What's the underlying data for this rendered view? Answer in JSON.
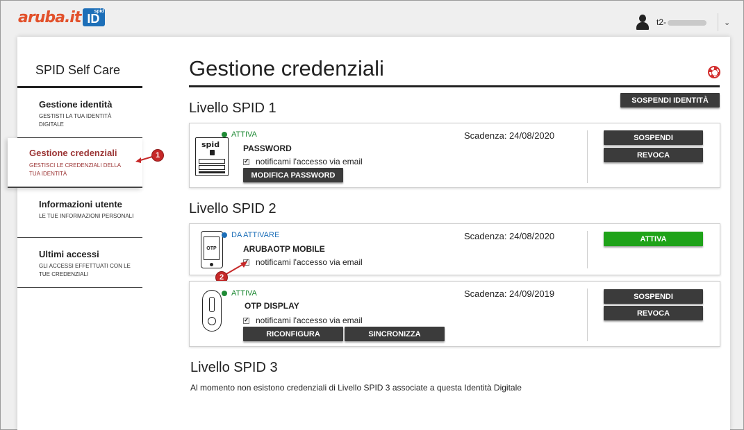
{
  "header": {
    "logo_text": "aruba.it",
    "logo_badge_top": "spid",
    "logo_badge_main": "ID",
    "user_prefix": "t2-"
  },
  "sidebar": {
    "title": "SPID Self Care",
    "items": [
      {
        "label": "Gestione identità",
        "sub": "GESTISTI LA TUA IDENTITÀ DIGITALE"
      },
      {
        "label": "Gestione credenziali",
        "sub": "GESTISCI LE CREDENZIALI DELLA TUA IDENTITÀ"
      },
      {
        "label": "Informazioni utente",
        "sub": "LE TUE INFORMAZIONI PERSONALI"
      },
      {
        "label": "Ultimi accessi",
        "sub": "GLI ACCESSI EFFETTUATI CON LE TUE CREDENZIALI"
      }
    ]
  },
  "callouts": [
    "1",
    "2"
  ],
  "main": {
    "title": "Gestione credenziali",
    "suspend_identity": "SOSPENDI IDENTITÀ",
    "level1": {
      "title": "Livello SPID 1",
      "cred": {
        "status": "ATTIVA",
        "name": "PASSWORD",
        "notify": "notificami l'accesso via email",
        "expiry": "Scadenza: 24/08/2020",
        "action": "MODIFICA PASSWORD",
        "btn1": "SOSPENDI",
        "btn2": "REVOCA",
        "device_label": "spid"
      }
    },
    "level2": {
      "title": "Livello SPID 2",
      "cred1": {
        "status": "DA ATTIVARE",
        "name": "ARUBAOTP MOBILE",
        "notify": "notificami l'accesso via email",
        "expiry": "Scadenza: 24/08/2020",
        "btn1": "ATTIVA",
        "device_label": "OTP"
      },
      "cred2": {
        "status": "ATTIVA",
        "name": "OTP DISPLAY",
        "notify": "notificami l'accesso via email",
        "expiry": "Scadenza: 24/09/2019",
        "action1": "RICONFIGURA",
        "action2": "SINCRONIZZA",
        "btn1": "SOSPENDI",
        "btn2": "REVOCA"
      }
    },
    "level3": {
      "title": "Livello SPID 3",
      "text": "Al momento non esistono credenziali di Livello SPID 3 associate a questa Identità Digitale"
    }
  },
  "colors": {
    "active": "#1e8a34",
    "pending": "#1d6fb8",
    "accent_red": "#9b3434",
    "green_button": "#1fa319",
    "dark_button": "#3b3b3b"
  }
}
